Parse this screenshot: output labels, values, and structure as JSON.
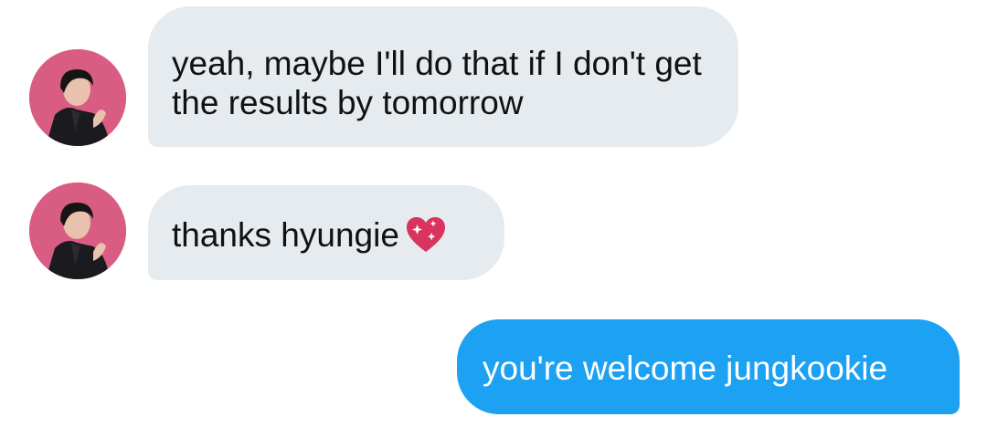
{
  "conversation": {
    "messages": [
      {
        "sender": "other",
        "text": "yeah, maybe I'll do that if I don't get the results by tomorrow"
      },
      {
        "sender": "other",
        "text": "thanks hyungie",
        "emoji": "sparkling-heart-icon"
      },
      {
        "sender": "me",
        "text": "you're welcome jungkookie"
      }
    ]
  },
  "colors": {
    "received_bubble": "#e6ebef",
    "sent_bubble": "#1da1f2",
    "avatar_background": "#d95d83"
  }
}
